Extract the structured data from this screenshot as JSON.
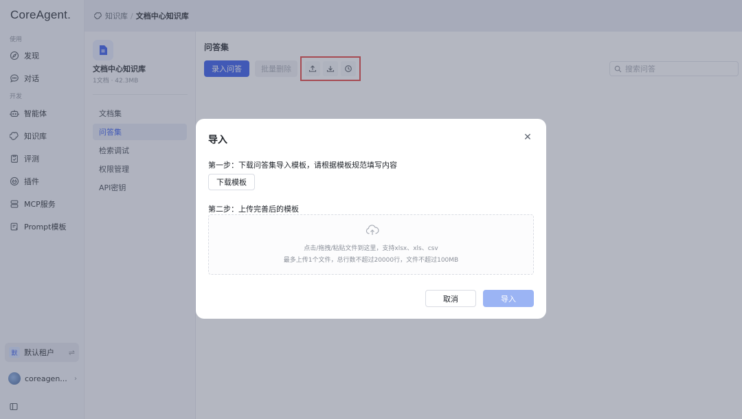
{
  "app": {
    "logo": "CoreAgent."
  },
  "sidebar": {
    "section_use": "使用",
    "section_dev": "开发",
    "items": [
      {
        "label": "发现",
        "icon": "compass-icon"
      },
      {
        "label": "对话",
        "icon": "chat-bubble-icon"
      },
      {
        "label": "智能体",
        "icon": "robot-icon"
      },
      {
        "label": "知识库",
        "icon": "knowledge-base-icon"
      },
      {
        "label": "评测",
        "icon": "clipboard-check-icon"
      },
      {
        "label": "插件",
        "icon": "plugin-icon"
      },
      {
        "label": "MCP服务",
        "icon": "server-icon"
      },
      {
        "label": "Prompt模板",
        "icon": "prompt-template-icon"
      }
    ],
    "tenant": {
      "badge": "默",
      "label": "默认租户"
    },
    "user": {
      "name": "coreagen..."
    }
  },
  "header": {
    "breadcrumb_root": "知识库",
    "breadcrumb_sep": "/",
    "breadcrumb_current": "文档中心知识库"
  },
  "kb": {
    "name": "文档中心知识库",
    "meta": "1文档 · 42.3MB",
    "menu": [
      "文档集",
      "问答集",
      "检索调试",
      "权限管理",
      "API密钥"
    ],
    "active_index": 1
  },
  "main": {
    "title": "问答集",
    "add_button": "录入问答",
    "batch_delete_button": "批量删除",
    "search_placeholder": "搜索问答"
  },
  "modal": {
    "title": "导入",
    "step1": "第一步：下载问答集导入模板，请根据模板规范填写内容",
    "download_button": "下载模板",
    "step2": "第二步：上传完善后的模板",
    "dropzone_line1": "点击/拖拽/粘贴文件到这里，支持xlsx、xls、csv",
    "dropzone_line2": "最多上传1个文件，总行数不超过20000行，文件不超过100MB",
    "cancel_button": "取消",
    "import_button": "导入"
  },
  "colors": {
    "primary": "#2f54eb",
    "primary_disabled": "#9bb4f4",
    "highlight_box": "#e53935"
  }
}
